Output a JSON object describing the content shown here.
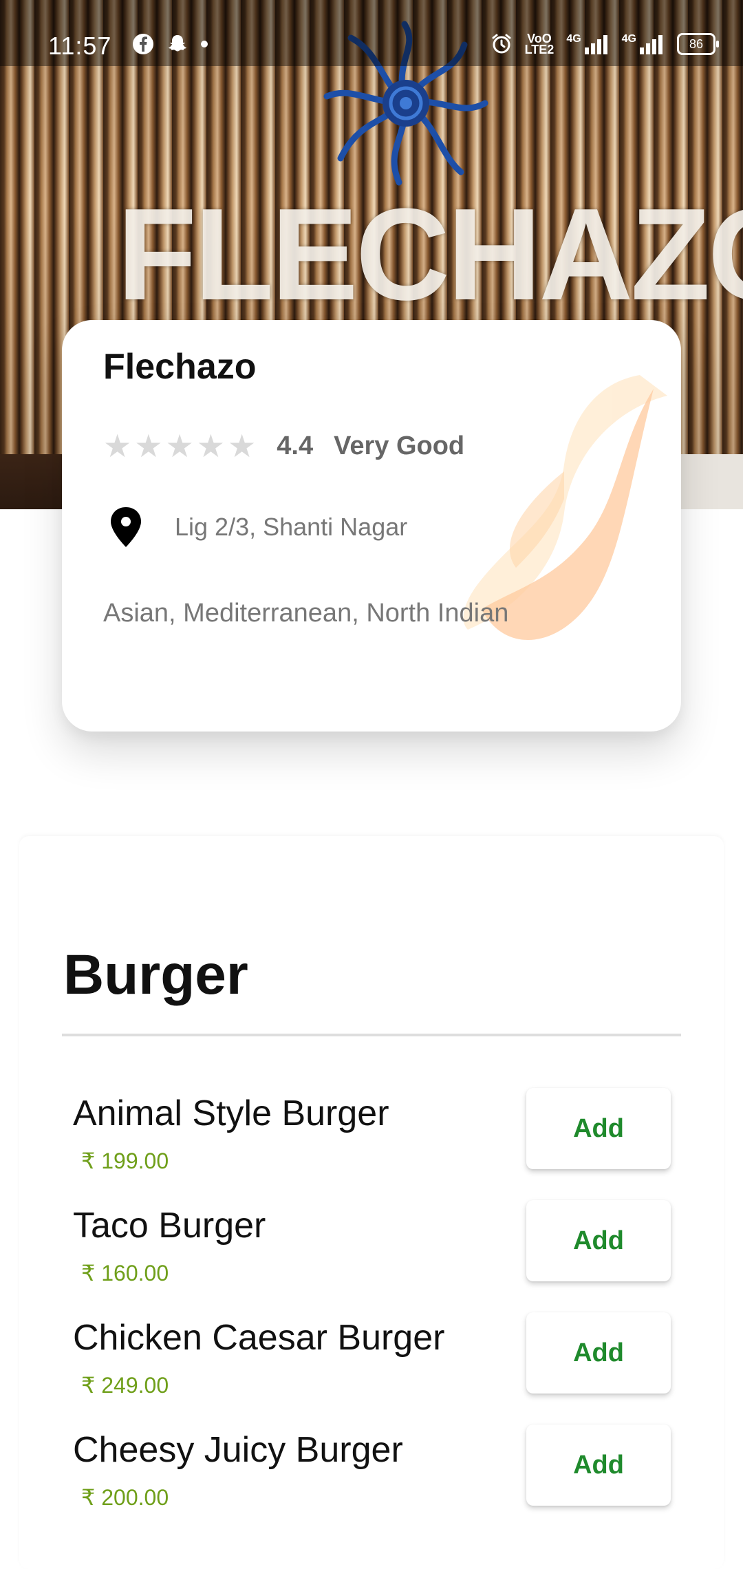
{
  "status_bar": {
    "time": "11:57",
    "volte_label_top": "VoO",
    "volte_label_bottom": "LTE2",
    "net1": "4G",
    "net2": "4G",
    "battery": "86"
  },
  "restaurant": {
    "name": "Flechazo",
    "rating": "4.4",
    "rating_text": "Very Good",
    "stars": 5,
    "address": "Lig 2/3, Shanti Nagar",
    "cuisines": "Asian, Mediterranean, North Indian",
    "hero_sign": "FLECHAZO"
  },
  "menu": {
    "section_title": "Burger",
    "add_label": "Add",
    "items": [
      {
        "name": "Animal Style Burger",
        "price": "₹ 199.00"
      },
      {
        "name": "Taco Burger",
        "price": "₹ 160.00"
      },
      {
        "name": "Chicken Caesar Burger",
        "price": "₹ 249.00"
      },
      {
        "name": "Cheesy Juicy Burger",
        "price": "₹ 200.00"
      }
    ]
  },
  "colors": {
    "add_text": "#1f8a2c",
    "price_text": "#6f9f1a",
    "star_empty": "#d9d9d9"
  }
}
